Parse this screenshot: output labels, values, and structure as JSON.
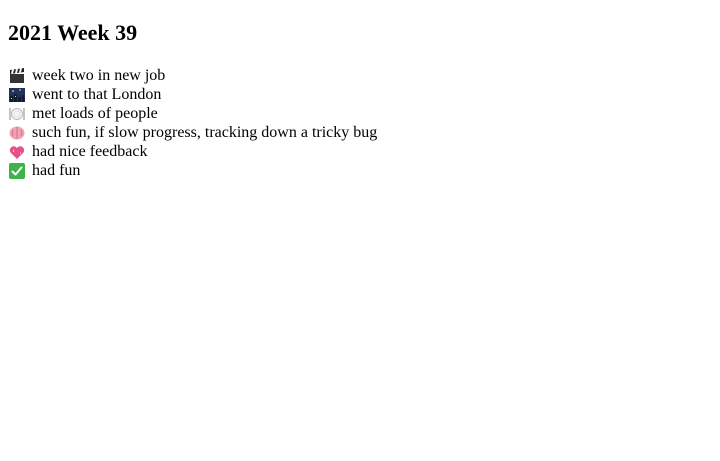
{
  "title": "2021 Week 39",
  "items": [
    {
      "icon": "clapper-board-icon",
      "text": "week two in new job"
    },
    {
      "icon": "night-city-icon",
      "text": "went to that London"
    },
    {
      "icon": "plate-icon",
      "text": "met loads of people"
    },
    {
      "icon": "brain-icon",
      "text": "such fun, if slow progress, tracking down a tricky bug"
    },
    {
      "icon": "sparkling-heart-icon",
      "text": "had nice feedback"
    },
    {
      "icon": "check-mark-icon",
      "text": "had fun"
    }
  ],
  "colors": {
    "text": "#000000",
    "background": "#ffffff",
    "check": "#3fb24a",
    "heart": "#e8508a",
    "brain": "#f2a3b3",
    "night": "#22335a"
  }
}
